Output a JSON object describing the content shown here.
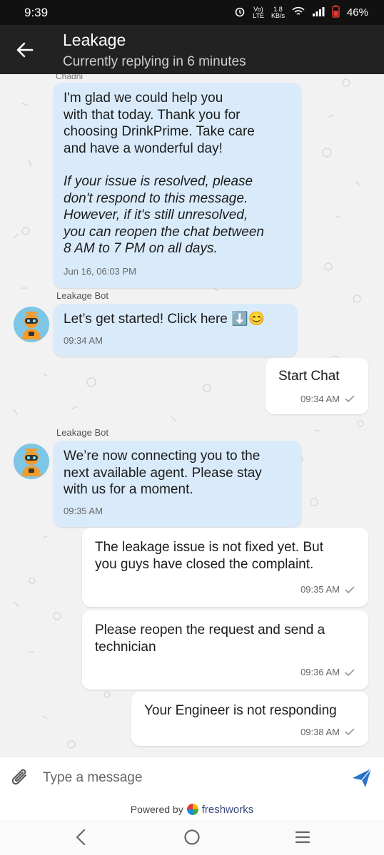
{
  "status_bar": {
    "time": "9:39",
    "network_top": "1.8",
    "network_bottom": "KB/s",
    "volte_top": "Vo)",
    "volte_bottom": "LTE",
    "battery": "46%"
  },
  "header": {
    "title": "Leakage",
    "subtitle": "Currently replying in 6 minutes"
  },
  "messages": [
    {
      "sender": "Chadni",
      "text": "I'm glad we could help you\nwith that today. Thank you for\nchoosing DrinkPrime. Take care\nand have a wonderful day!",
      "italic": "If your issue is resolved, please\ndon't respond to this message.\nHowever, if it's still unresolved,\nyou can reopen the chat between\n8 AM to 7 PM on all days.",
      "time": "Jun 16, 06:03 PM"
    },
    {
      "sender": "Leakage Bot",
      "text": "Let’s get started! Click here ⬇️😊",
      "time": "09:34 AM"
    },
    {
      "text": "Start Chat",
      "time": "09:34 AM"
    },
    {
      "sender": "Leakage Bot",
      "text": "We’re now connecting you to the\nnext available agent. Please stay\nwith us for a moment.",
      "time": "09:35 AM"
    },
    {
      "text": "The leakage issue is not fixed yet. But\nyou guys have closed the complaint.",
      "time": "09:35 AM"
    },
    {
      "text": "Please reopen the request and send a\ntechnician",
      "time": "09:36 AM"
    },
    {
      "text": "Your Engineer is not responding",
      "time": "09:38 AM"
    }
  ],
  "composer": {
    "placeholder": "Type a message"
  },
  "footer": {
    "powered_by": "Powered by",
    "brand": "freshworks"
  },
  "colors": {
    "header_bg": "#222222",
    "incoming_bubble": "#d9ebfb",
    "outgoing_bubble": "#ffffff",
    "send_icon": "#2a73c9",
    "avatar_bg": "#7ec6e6"
  }
}
